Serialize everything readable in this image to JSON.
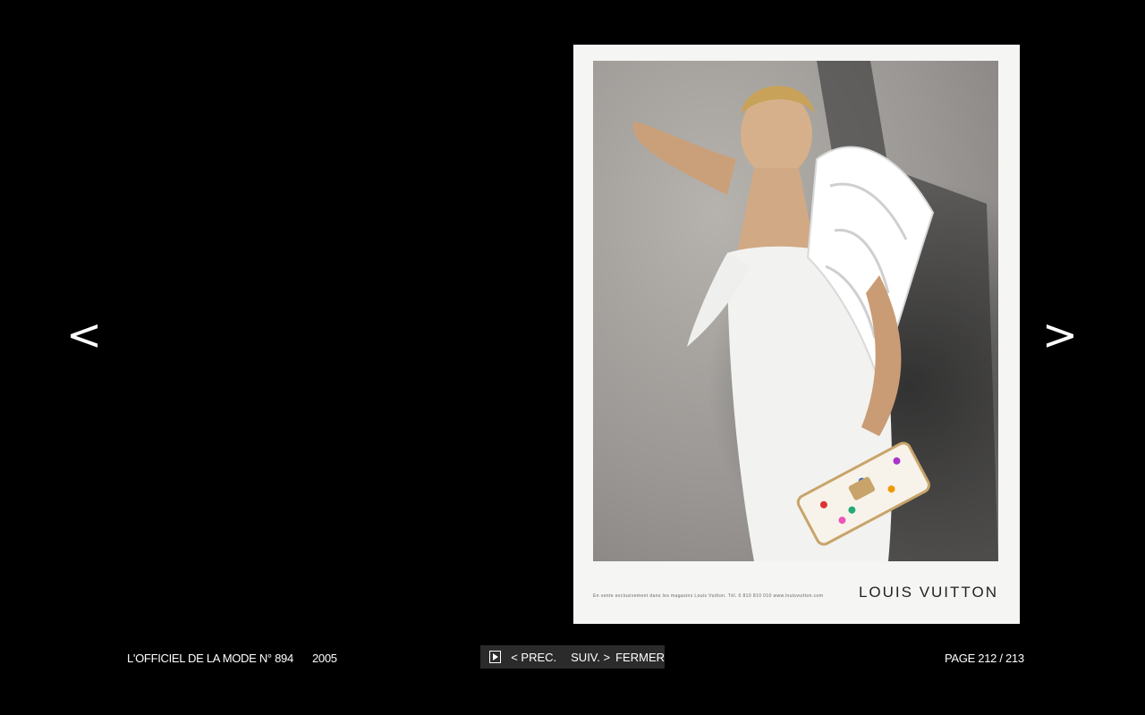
{
  "nav": {
    "prev_arrow": "<",
    "next_arrow": ">"
  },
  "magazine_page": {
    "legal_text": "En vente exclusivement dans les magasins Louis Vuitton. Tél. 0 810 810 010 www.louisvuitton.com",
    "brand": "LOUIS VUITTON"
  },
  "footer": {
    "publication": "L'OFFICIEL DE LA MODE N° 894",
    "year": "2005",
    "prev_label": "< PREC.",
    "next_label": "SUIV. >",
    "close_label": "FERMER",
    "page_indicator": "PAGE 212 / 213"
  },
  "colors": {
    "background": "#000000",
    "control_bar": "#2b2b2b",
    "text": "#ffffff"
  }
}
